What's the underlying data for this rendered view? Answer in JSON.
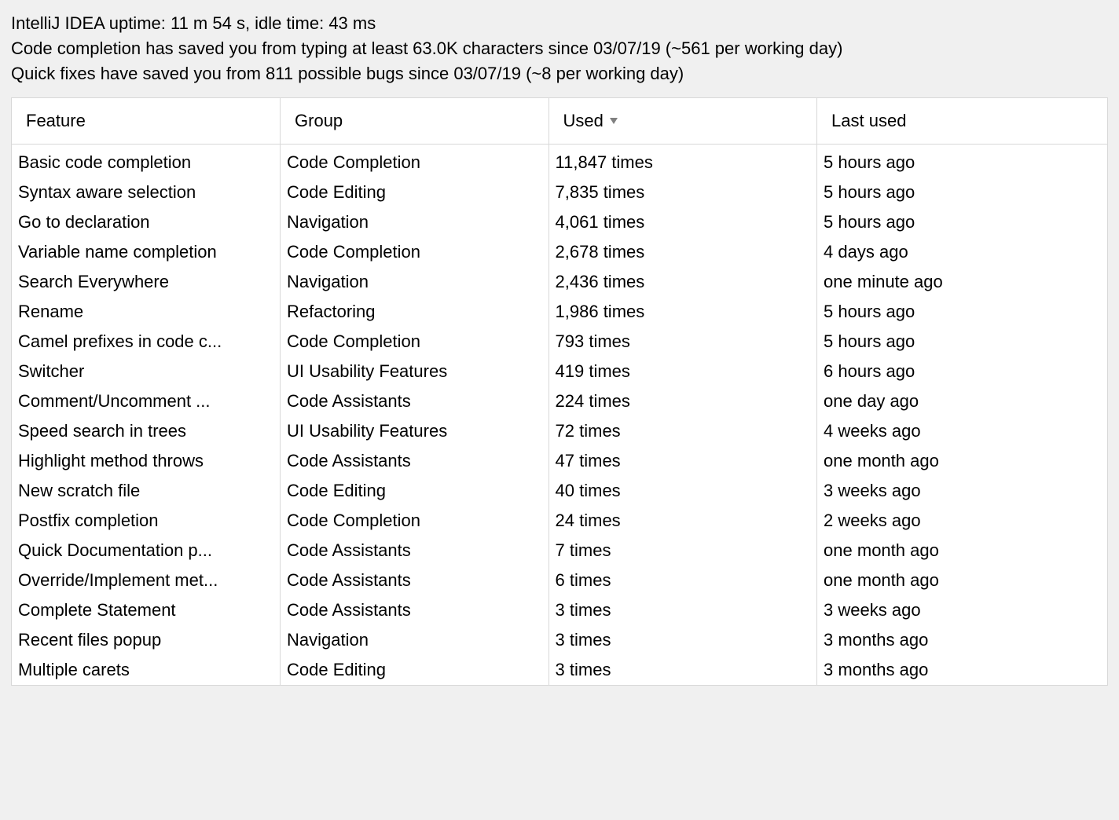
{
  "summary": {
    "line1": "IntelliJ IDEA uptime: 11 m 54 s, idle time: 43 ms",
    "line2": "Code completion has saved you from typing at least 63.0K characters since 03/07/19 (~561 per working day)",
    "line3": "Quick fixes have saved you from 811 possible bugs since 03/07/19 (~8 per working day)"
  },
  "table": {
    "headers": {
      "feature": "Feature",
      "group": "Group",
      "used": "Used",
      "last_used": "Last used"
    },
    "rows": [
      {
        "feature": "Basic code completion",
        "group": "Code Completion",
        "used": "11,847 times",
        "last_used": "5 hours ago"
      },
      {
        "feature": "Syntax aware selection",
        "group": "Code Editing",
        "used": "7,835 times",
        "last_used": "5 hours ago"
      },
      {
        "feature": "Go to declaration",
        "group": "Navigation",
        "used": "4,061 times",
        "last_used": "5 hours ago"
      },
      {
        "feature": "Variable name completion",
        "group": "Code Completion",
        "used": "2,678 times",
        "last_used": "4 days ago"
      },
      {
        "feature": "Search Everywhere",
        "group": "Navigation",
        "used": "2,436 times",
        "last_used": "one minute ago"
      },
      {
        "feature": "Rename",
        "group": "Refactoring",
        "used": "1,986 times",
        "last_used": "5 hours ago"
      },
      {
        "feature": "Camel prefixes in code c...",
        "group": "Code Completion",
        "used": "793 times",
        "last_used": "5 hours ago"
      },
      {
        "feature": "Switcher",
        "group": "UI Usability Features",
        "used": "419 times",
        "last_used": "6 hours ago"
      },
      {
        "feature": "Comment/Uncomment ...",
        "group": "Code Assistants",
        "used": "224 times",
        "last_used": "one day ago"
      },
      {
        "feature": "Speed search in trees",
        "group": "UI Usability Features",
        "used": "72 times",
        "last_used": "4 weeks ago"
      },
      {
        "feature": "Highlight method throws",
        "group": "Code Assistants",
        "used": "47 times",
        "last_used": "one month ago"
      },
      {
        "feature": "New scratch file",
        "group": "Code Editing",
        "used": "40 times",
        "last_used": "3 weeks ago"
      },
      {
        "feature": "Postfix completion",
        "group": "Code Completion",
        "used": "24 times",
        "last_used": "2 weeks ago"
      },
      {
        "feature": "Quick Documentation p...",
        "group": "Code Assistants",
        "used": "7 times",
        "last_used": "one month ago"
      },
      {
        "feature": "Override/Implement met...",
        "group": "Code Assistants",
        "used": "6 times",
        "last_used": "one month ago"
      },
      {
        "feature": "Complete Statement",
        "group": "Code Assistants",
        "used": "3 times",
        "last_used": "3 weeks ago"
      },
      {
        "feature": "Recent files popup",
        "group": "Navigation",
        "used": "3 times",
        "last_used": "3 months ago"
      },
      {
        "feature": "Multiple carets",
        "group": "Code Editing",
        "used": "3 times",
        "last_used": "3 months ago"
      }
    ]
  }
}
